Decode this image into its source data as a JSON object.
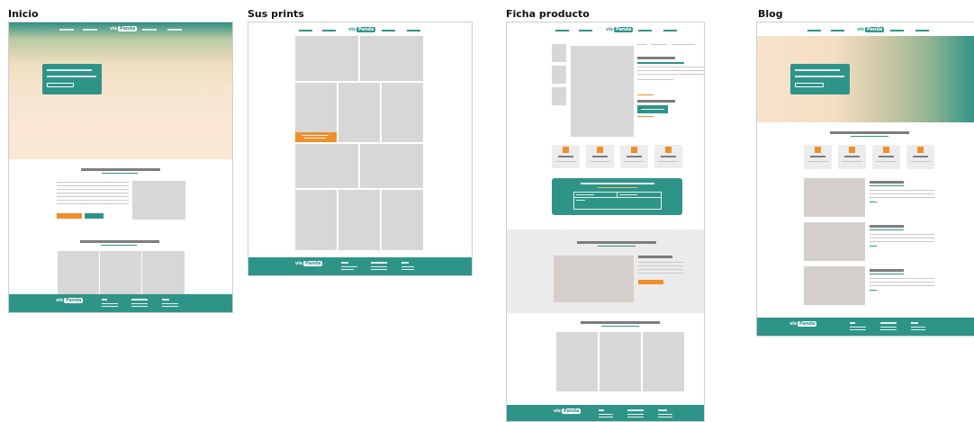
{
  "frames": [
    {
      "id": "inicio",
      "title": "Inicio"
    },
    {
      "id": "sus-prints",
      "title": "Sus prints"
    },
    {
      "id": "ficha-producto",
      "title": "Ficha producto"
    },
    {
      "id": "blog",
      "title": "Blog"
    }
  ],
  "brand": {
    "prefix": "vis",
    "highlight": "Panda"
  },
  "colors": {
    "primary": "#2f9488",
    "accent": "#ef8f2a",
    "placeholder": "#d7d7d7",
    "hero_peach": "#f9e6d2"
  }
}
